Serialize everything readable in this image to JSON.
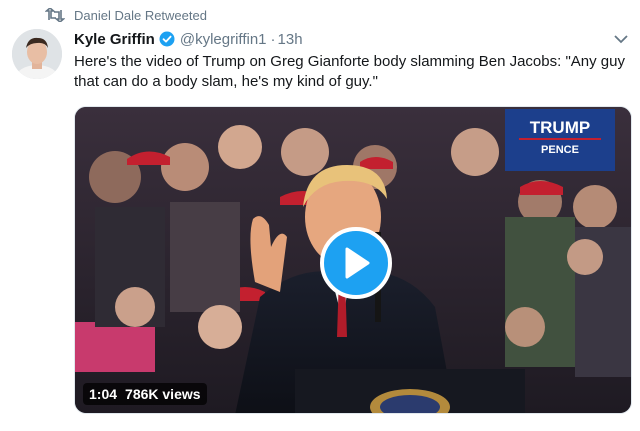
{
  "retweet": {
    "icon": "retweet-icon",
    "text": "Daniel Dale Retweeted"
  },
  "tweet": {
    "author_name": "Kyle Griffin",
    "verified_icon": "verified-badge-icon",
    "handle": "@kylegriffin1",
    "separator": "·",
    "time": "13h",
    "text": "Here's the video of Trump on Greg Gianforte body slamming Ben Jacobs: \"Any guy that can do a body slam, he's my kind of guy.\"",
    "menu_icon": "chevron-down-icon"
  },
  "video": {
    "duration": "1:04",
    "views": "786K views",
    "play_icon": "play-icon",
    "sign_text": "TRUMP",
    "sign_subtext": "PENCE"
  },
  "colors": {
    "accent": "#1da1f2",
    "text_primary": "#14171a",
    "text_secondary": "#657786"
  }
}
